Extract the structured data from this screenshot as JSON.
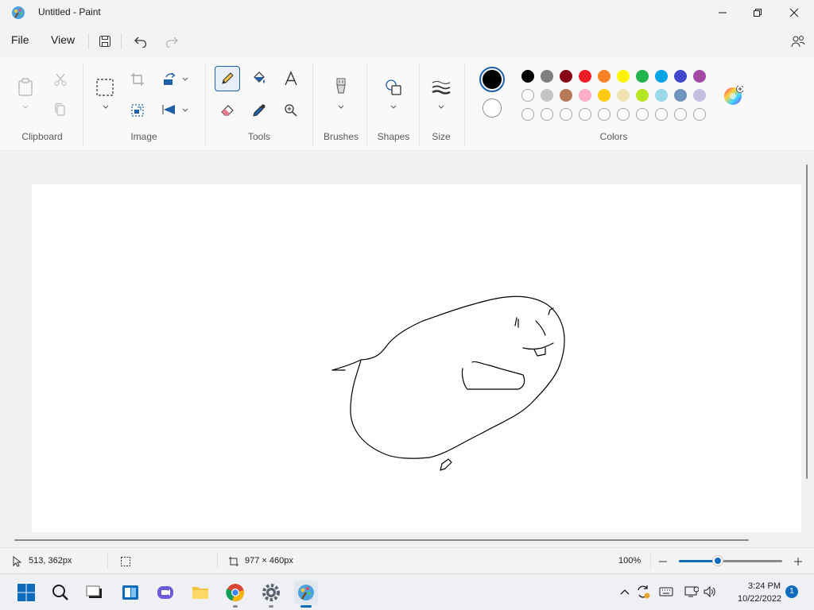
{
  "window": {
    "title": "Untitled - Paint"
  },
  "menu": {
    "file": "File",
    "view": "View"
  },
  "ribbon": {
    "groups": {
      "clipboard": "Clipboard",
      "image": "Image",
      "tools": "Tools",
      "brushes": "Brushes",
      "shapes": "Shapes",
      "size": "Size",
      "colors": "Colors"
    }
  },
  "colors": {
    "primary": "#000000",
    "secondary": "#ffffff",
    "palette_row1": [
      "#000000",
      "#7f7f7f",
      "#880015",
      "#ed1c24",
      "#ff7f27",
      "#fff200",
      "#22b14c",
      "#00a2e8",
      "#3f48cc",
      "#a349a4"
    ],
    "palette_row2": [
      "#ffffff",
      "#c3c3c3",
      "#b97a57",
      "#ffaec9",
      "#ffc90e",
      "#efe4b0",
      "#b5e61d",
      "#99d9ea",
      "#7092be",
      "#c8bfe7"
    ],
    "palette_row3_empty": 10
  },
  "status": {
    "cursor_position": "513, 362px",
    "canvas_size": "977 × 460px",
    "zoom": "100%",
    "zoom_fraction": 0.38
  },
  "taskbar": {
    "time": "3:24 PM",
    "date": "10/22/2022",
    "notification_count": "1"
  }
}
